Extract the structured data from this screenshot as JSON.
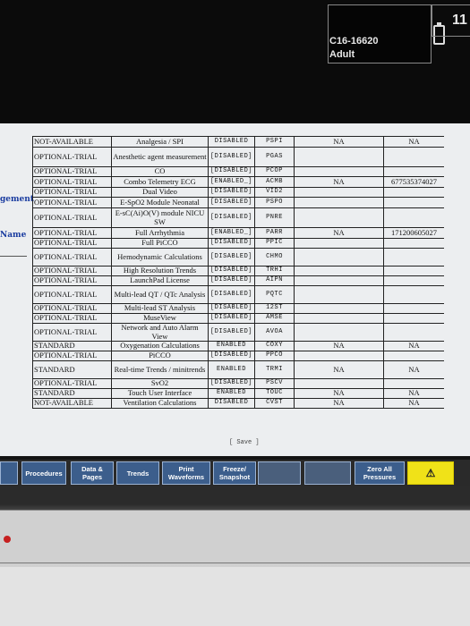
{
  "header": {
    "bed_label": "C16-16620",
    "patient_type": "Adult",
    "clock_partial": "11"
  },
  "left_panel": {
    "label_a": "gement",
    "label_b": "Name"
  },
  "options_table": {
    "rows": [
      {
        "status": "NOT-AVAILABLE",
        "name": "Analgesia / SPI",
        "state": "DISABLED",
        "code": "PSPI",
        "serial": "NA",
        "extra": "NA"
      },
      {
        "status": "OPTIONAL-TRIAL",
        "name": "Anesthetic agent measurement",
        "state": "[DISABLED]",
        "code": "PGAS",
        "serial": "",
        "extra": ""
      },
      {
        "status": "OPTIONAL-TRIAL",
        "name": "CO",
        "state": "[DISABLED]",
        "code": "PCOP",
        "serial": "",
        "extra": ""
      },
      {
        "status": "OPTIONAL-TRIAL",
        "name": "Combo Telemetry ECG",
        "state": "[ENABLED_]",
        "code": "ACMB",
        "serial": "NA",
        "extra": "677535374027"
      },
      {
        "status": "OPTIONAL-TRIAL",
        "name": "Dual Video",
        "state": "[DISABLED]",
        "code": "VID2",
        "serial": "",
        "extra": ""
      },
      {
        "status": "OPTIONAL-TRIAL",
        "name": "E-SpO2 Module Neonatal",
        "state": "[DISABLED]",
        "code": "PSPO",
        "serial": "",
        "extra": ""
      },
      {
        "status": "OPTIONAL-TRIAL",
        "name": "E-sC(Ai)O(V) module NICU SW",
        "state": "[DISABLED]",
        "code": "PNRE",
        "serial": "",
        "extra": ""
      },
      {
        "status": "OPTIONAL-TRIAL",
        "name": "Full Arrhythmia",
        "state": "[ENABLED_]",
        "code": "PARR",
        "serial": "NA",
        "extra": "171200605027"
      },
      {
        "status": "OPTIONAL-TRIAL",
        "name": "Full PiCCO",
        "state": "[DISABLED]",
        "code": "PPIC",
        "serial": "",
        "extra": ""
      },
      {
        "status": "OPTIONAL-TRIAL",
        "name": "Hemodynamic Calculations",
        "state": "[DISABLED]",
        "code": "CHMO",
        "serial": "",
        "extra": ""
      },
      {
        "status": "OPTIONAL-TRIAL",
        "name": "High Resolution Trends",
        "state": "[DISABLED]",
        "code": "TRHI",
        "serial": "",
        "extra": ""
      },
      {
        "status": "OPTIONAL-TRIAL",
        "name": "LaunchPad License",
        "state": "[DISABLED]",
        "code": "AIPN",
        "serial": "",
        "extra": ""
      },
      {
        "status": "OPTIONAL-TRIAL",
        "name": "Multi-lead QT / QTc Analysis",
        "state": "[DISABLED]",
        "code": "PQTC",
        "serial": "",
        "extra": ""
      },
      {
        "status": "OPTIONAL-TRIAL",
        "name": "Multi-lead ST Analysis",
        "state": "[DISABLED]",
        "code": "12ST",
        "serial": "",
        "extra": ""
      },
      {
        "status": "OPTIONAL-TRIAL",
        "name": "MuseView",
        "state": "[DISABLED]",
        "code": "AMSE",
        "serial": "",
        "extra": ""
      },
      {
        "status": "OPTIONAL-TRIAL",
        "name": "Network and Auto Alarm View",
        "state": "[DISABLED]",
        "code": "AVOA",
        "serial": "",
        "extra": ""
      },
      {
        "status": "STANDARD",
        "name": "Oxygenation Calculations",
        "state": "ENABLED",
        "code": "COXY",
        "serial": "NA",
        "extra": "NA"
      },
      {
        "status": "OPTIONAL-TRIAL",
        "name": "PiCCO",
        "state": "[DISABLED]",
        "code": "PPCO",
        "serial": "",
        "extra": ""
      },
      {
        "status": "STANDARD",
        "name": "Real-time Trends / minitrends",
        "state": "ENABLED",
        "code": "TRMI",
        "serial": "NA",
        "extra": "NA"
      },
      {
        "status": "OPTIONAL-TRIAL",
        "name": "SvO2",
        "state": "[DISABLED]",
        "code": "PSCV",
        "serial": "",
        "extra": ""
      },
      {
        "status": "STANDARD",
        "name": "Touch User Interface",
        "state": "ENABLED",
        "code": "TOUC",
        "serial": "NA",
        "extra": "NA"
      },
      {
        "status": "NOT-AVAILABLE",
        "name": "Ventilation Calculations",
        "state": "DISABLED",
        "code": "CVST",
        "serial": "NA",
        "extra": "NA"
      }
    ],
    "save_label": "[ Save ]"
  },
  "buttons": [
    {
      "label": "Procedures",
      "dim": false
    },
    {
      "label": "Data & Pages",
      "dim": false
    },
    {
      "label": "Trends",
      "dim": false
    },
    {
      "label": "Print Waveforms",
      "dim": false
    },
    {
      "label": "Freeze/ Snapshot",
      "dim": false
    },
    {
      "label": "",
      "dim": true
    },
    {
      "label": "",
      "dim": true
    },
    {
      "label": "Zero All Pressures",
      "dim": false
    },
    {
      "label": "⚠",
      "dim": false
    }
  ]
}
